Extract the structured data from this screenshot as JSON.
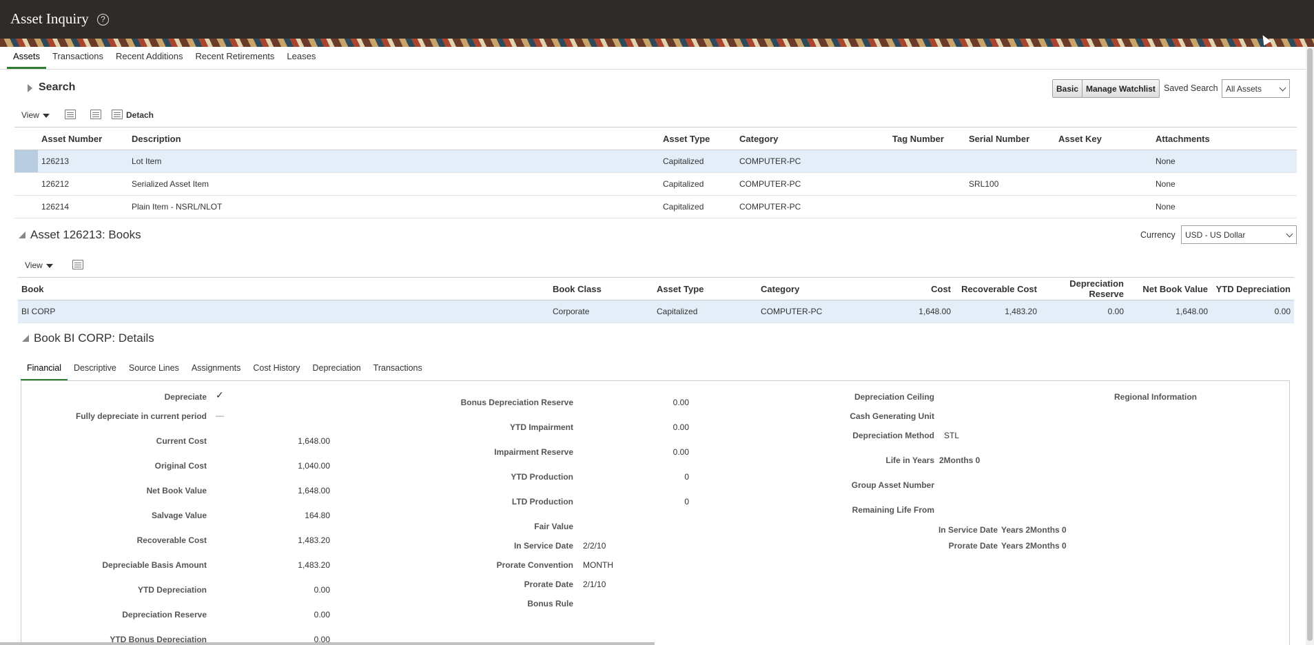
{
  "app": {
    "title": "Asset Inquiry",
    "help_glyph": "?"
  },
  "page_tabs": [
    "Assets",
    "Transactions",
    "Recent Additions",
    "Recent Retirements",
    "Leases"
  ],
  "search": {
    "title": "Search",
    "basic_label": "Basic",
    "manage_watchlist_label": "Manage Watchlist",
    "saved_search_label": "Saved Search",
    "saved_search_value": "All Assets"
  },
  "toolbar": {
    "view_label": "View",
    "detach_label": "Detach"
  },
  "assets_table": {
    "headers": [
      "Asset Number",
      "Description",
      "Asset Type",
      "Category",
      "Tag Number",
      "Serial Number",
      "Asset Key",
      "Attachments"
    ],
    "rows": [
      [
        "126213",
        "Lot Item",
        "Capitalized",
        "COMPUTER-PC",
        "",
        "",
        "",
        "None"
      ],
      [
        "126212",
        "Serialized Asset Item",
        "Capitalized",
        "COMPUTER-PC",
        "",
        "SRL100",
        "",
        "None"
      ],
      [
        "126214",
        "Plain Item - NSRL/NLOT",
        "Capitalized",
        "COMPUTER-PC",
        "",
        "",
        "",
        "None"
      ]
    ]
  },
  "books": {
    "title": "Asset 126213: Books",
    "currency_label": "Currency",
    "currency_value": "USD - US Dollar",
    "view_label": "View",
    "headers": [
      "Book",
      "Book Class",
      "Asset Type",
      "Category",
      "Cost",
      "Recoverable Cost",
      "Depreciation Reserve",
      "Net Book Value",
      "YTD Depreciation"
    ],
    "rows": [
      [
        "BI CORP",
        "Corporate",
        "Capitalized",
        "COMPUTER-PC",
        "1,648.00",
        "1,483.20",
        "0.00",
        "1,648.00",
        "0.00"
      ]
    ]
  },
  "details": {
    "title": "Book BI CORP: Details",
    "tabs": [
      "Financial",
      "Descriptive",
      "Source Lines",
      "Assignments",
      "Cost History",
      "Depreciation",
      "Transactions"
    ],
    "col1": [
      {
        "label": "Depreciate",
        "value": "✓"
      },
      {
        "label": "Fully depreciate in current period",
        "value": "—"
      },
      {
        "label": "Current Cost",
        "value": "1,648.00"
      },
      {
        "label": "Original Cost",
        "value": "1,040.00"
      },
      {
        "label": "Net Book Value",
        "value": "1,648.00"
      },
      {
        "label": "Salvage Value",
        "value": "164.80"
      },
      {
        "label": "Recoverable Cost",
        "value": "1,483.20"
      },
      {
        "label": "Depreciable Basis Amount",
        "value": "1,483.20"
      },
      {
        "label": "YTD Depreciation",
        "value": "0.00"
      },
      {
        "label": "Depreciation Reserve",
        "value": "0.00"
      },
      {
        "label": "YTD Bonus Depreciation",
        "value": "0.00"
      }
    ],
    "col2": [
      {
        "label": "Bonus Depreciation Reserve",
        "value": "0.00"
      },
      {
        "label": "YTD Impairment",
        "value": "0.00"
      },
      {
        "label": "Impairment Reserve",
        "value": "0.00"
      },
      {
        "label": "YTD Production",
        "value": "0"
      },
      {
        "label": "LTD Production",
        "value": "0"
      },
      {
        "label": "Fair Value",
        "value": ""
      },
      {
        "label": "In Service Date",
        "value": "2/2/10"
      },
      {
        "label": "Prorate Convention",
        "value": "MONTH"
      },
      {
        "label": "Prorate Date",
        "value": "2/1/10"
      },
      {
        "label": "Bonus Rule",
        "value": ""
      }
    ],
    "col3": [
      {
        "label": "Depreciation Ceiling",
        "value": ""
      },
      {
        "label": "Cash Generating Unit",
        "value": ""
      },
      {
        "label": "Depreciation Method",
        "value": "STL"
      },
      {
        "label": "Life in Years",
        "value": "2Months  0"
      },
      {
        "label": "Group Asset Number",
        "value": ""
      },
      {
        "label": "Remaining Life From",
        "value": ""
      }
    ],
    "remaining": [
      {
        "label": "In Service Date",
        "value": "Years  2Months  0"
      },
      {
        "label": "Prorate Date",
        "value": "Years  2Months  0"
      }
    ],
    "regional_label": "Regional Information"
  }
}
